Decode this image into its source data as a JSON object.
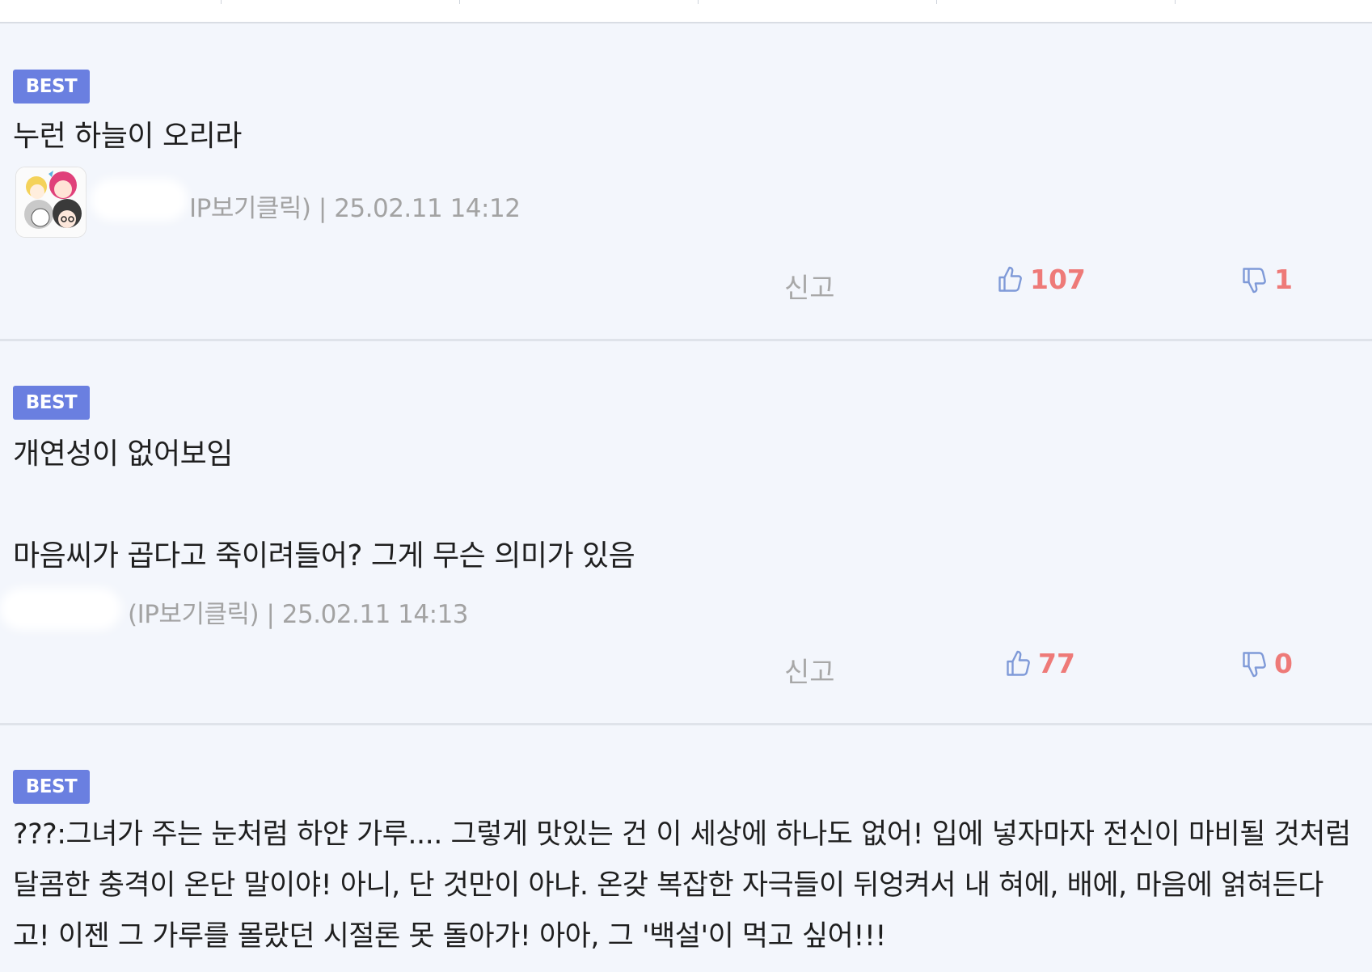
{
  "comments": [
    {
      "badge": "BEST",
      "text": "누런 하늘이 오리라",
      "author_suffix": "IP보기클릭)",
      "separator": "|",
      "datetime": "25.02.11 14:12",
      "report_label": "신고",
      "likes": "107",
      "dislikes": "1",
      "has_avatar": true
    },
    {
      "badge": "BEST",
      "text": "개연성이 없어보임\n\n마음씨가 곱다고 죽이려들어? 그게 무슨 의미가 있음",
      "author_suffix": "(IP보기클릭)",
      "separator": "|",
      "datetime": "25.02.11 14:13",
      "report_label": "신고",
      "likes": "77",
      "dislikes": "0",
      "has_avatar": false
    },
    {
      "badge": "BEST",
      "text": "???:그녀가 주는 눈처럼 하얀 가루.... 그렇게 맛있는 건 이 세상에 하나도 없어! 입에 넣자마자 전신이 마비될 것처럼 달콤한 충격이 온단 말이야! 아니, 단 것만이 아냐. 온갖 복잡한 자극들이 뒤엉켜서 내 혀에, 배에, 마음에 얽혀든다고! 이젠 그 가루를 몰랐던 시절론 못 돌아가! 아아, 그 '백설'이 먹고 싶어!!!"
    }
  ],
  "colors": {
    "badge": "#6a7fe0",
    "vote_count": "#ee7a78",
    "vote_icon": "#7f9ad8",
    "meta": "#a3a3a3",
    "background": "#f3f6fc"
  },
  "icons": {
    "like": "thumbs-up-icon",
    "dislike": "thumbs-down-icon"
  }
}
